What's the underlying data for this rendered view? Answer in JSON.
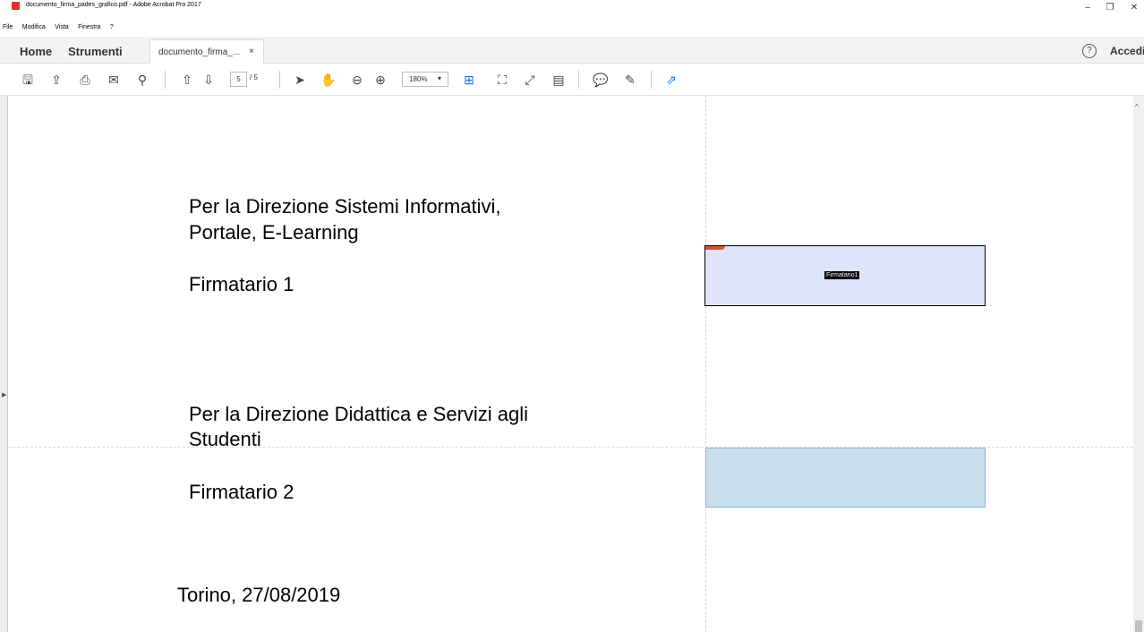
{
  "window": {
    "title": "documento_firma_pades_grafico.pdf - Adobe Acrobat Pro 2017",
    "minimize": "–",
    "restore": "❐",
    "close": "✕"
  },
  "menu": [
    "File",
    "Modifica",
    "Vista",
    "Finestra",
    "?"
  ],
  "tabs": {
    "home": "Home",
    "tools": "Strumenti",
    "document": "documento_firma_...",
    "close": "×",
    "help": "?",
    "signin": "Accedi"
  },
  "toolbar": {
    "page_current": "5",
    "page_total": "/ 5",
    "zoom": "180%",
    "zoom_arrow": "▾"
  },
  "document": {
    "line1": "Per  la  Direzione  Sistemi  Informativi,",
    "line2": "Portale, E-Learning",
    "signer1": "Firmatario 1",
    "line3": "Per la Direzione Didattica e Servizi agli",
    "line4": "Studenti",
    "signer2": "Firmatario 2",
    "date": "Torino, 27/08/2019"
  },
  "fields": {
    "sig1_label": "Firmatario1"
  },
  "icons": {
    "save": "🖫",
    "upload": "⇪",
    "print": "⎙",
    "mail": "✉",
    "search": "⚲",
    "prev": "⇧",
    "next": "⇩",
    "select": "➤",
    "hand": "✋",
    "zoom_out": "⊖",
    "zoom_in": "⊕",
    "fit": "⊞",
    "full": "⛶",
    "expand": "⤢",
    "read": "▤",
    "comment": "💬",
    "sign": "✎",
    "share": "⇗"
  },
  "colors": {
    "accent": "#1473e6",
    "sig1_bg": "#dfe3fb",
    "sig2_bg": "#c9dfec"
  }
}
